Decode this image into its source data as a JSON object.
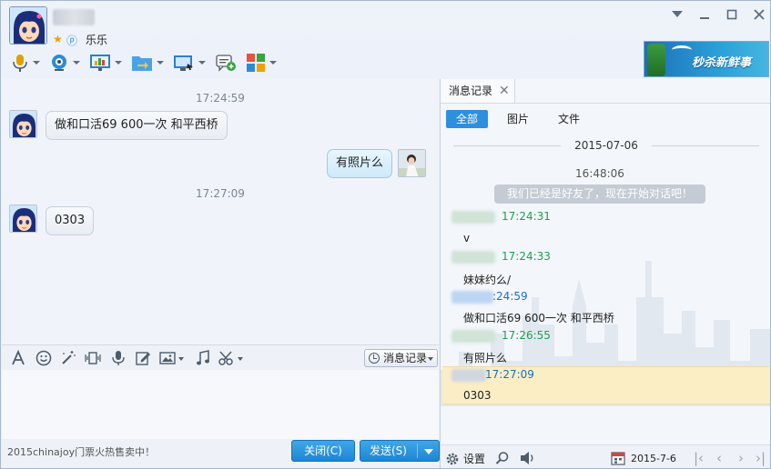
{
  "header": {
    "status_text": "乐乐"
  },
  "ad": {
    "text": "秒杀新鲜事"
  },
  "chat": {
    "messages": [
      {
        "time": "17:24:59",
        "text": "做和口活69 600一次 和平西桥",
        "from": "other"
      },
      {
        "text": "有照片么",
        "from": "self"
      },
      {
        "time": "17:27:09",
        "text": "0303",
        "from": "other"
      }
    ]
  },
  "input_toolbar": {
    "history_label": "消息记录"
  },
  "bottom": {
    "promo": "2015chinajoy门票火热售卖中！",
    "close_label": "关闭(C)",
    "send_label": "发送(S)"
  },
  "history": {
    "tab_label": "消息记录",
    "filters": [
      "全部",
      "图片",
      "文件"
    ],
    "date": "2015-07-06",
    "system_time": "16:48:06",
    "system_message": "我们已经是好友了，现在开始对话吧！",
    "records": [
      {
        "time": "17:24:31",
        "text": "v",
        "color": "#1f9e4f"
      },
      {
        "time": "17:24:33",
        "text": "妹妹约么/",
        "color": "#1f9e4f"
      },
      {
        "time": ":24:59",
        "text": "做和口活69 600一次 和平西桥",
        "color": "#1a6fc9"
      },
      {
        "time": "17:26:55",
        "text": "有照片么",
        "color": "#1f9e4f"
      },
      {
        "time": "17:27:09",
        "text": "0303",
        "color": "#1a6fc9"
      }
    ],
    "settings_label": "设置",
    "calendar_date": "2015-7-6"
  },
  "colors": {
    "accent": "#2e8fde",
    "highlight": "#fbeec4",
    "self_bubble": "#cfe9f9"
  }
}
